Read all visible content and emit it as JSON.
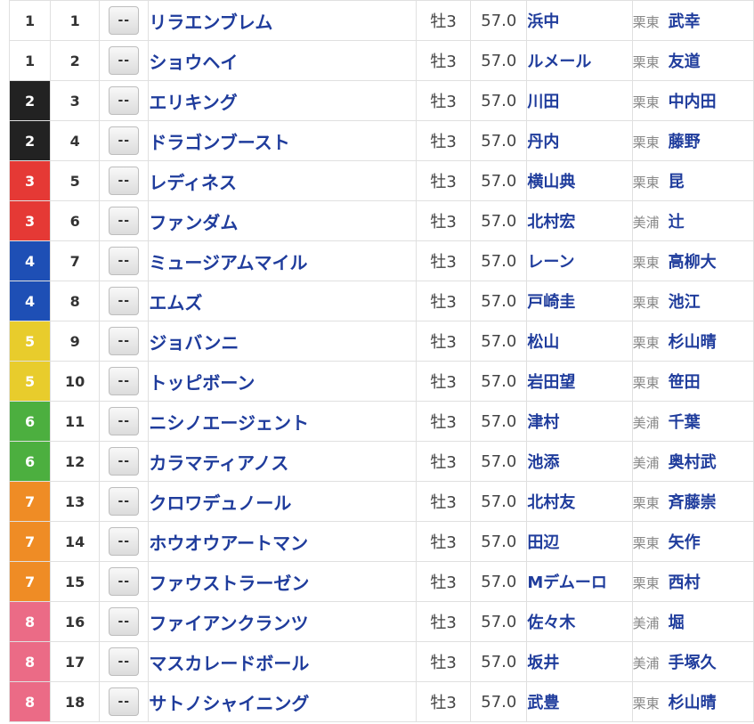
{
  "colors": {
    "waku": {
      "1": [
        "#ffffff",
        "#333333"
      ],
      "2": [
        "#222222",
        "#ffffff"
      ],
      "3": [
        "#e53935",
        "#ffffff"
      ],
      "4": [
        "#1e4fb5",
        "#ffffff"
      ],
      "5": [
        "#e8cc2c",
        "#ffffff"
      ],
      "6": [
        "#4caf3f",
        "#ffffff"
      ],
      "7": [
        "#ef8c25",
        "#ffffff"
      ],
      "8": [
        "#eb6b86",
        "#ffffff"
      ]
    },
    "link": "#1f3c9c"
  },
  "entries": [
    {
      "waku": "1",
      "umaban": "1",
      "mark": "--",
      "horse": "リラエンブレム",
      "sexage": "牡3",
      "weight": "57.0",
      "jockey": "浜中",
      "stable": "栗東",
      "trainer": "武幸"
    },
    {
      "waku": "1",
      "umaban": "2",
      "mark": "--",
      "horse": "ショウヘイ",
      "sexage": "牡3",
      "weight": "57.0",
      "jockey": "ルメール",
      "stable": "栗東",
      "trainer": "友道"
    },
    {
      "waku": "2",
      "umaban": "3",
      "mark": "--",
      "horse": "エリキング",
      "sexage": "牡3",
      "weight": "57.0",
      "jockey": "川田",
      "stable": "栗東",
      "trainer": "中内田"
    },
    {
      "waku": "2",
      "umaban": "4",
      "mark": "--",
      "horse": "ドラゴンブースト",
      "sexage": "牡3",
      "weight": "57.0",
      "jockey": "丹内",
      "stable": "栗東",
      "trainer": "藤野"
    },
    {
      "waku": "3",
      "umaban": "5",
      "mark": "--",
      "horse": "レディネス",
      "sexage": "牡3",
      "weight": "57.0",
      "jockey": "横山典",
      "stable": "栗東",
      "trainer": "昆"
    },
    {
      "waku": "3",
      "umaban": "6",
      "mark": "--",
      "horse": "ファンダム",
      "sexage": "牡3",
      "weight": "57.0",
      "jockey": "北村宏",
      "stable": "美浦",
      "trainer": "辻"
    },
    {
      "waku": "4",
      "umaban": "7",
      "mark": "--",
      "horse": "ミュージアムマイル",
      "sexage": "牡3",
      "weight": "57.0",
      "jockey": "レーン",
      "stable": "栗東",
      "trainer": "高柳大"
    },
    {
      "waku": "4",
      "umaban": "8",
      "mark": "--",
      "horse": "エムズ",
      "sexage": "牡3",
      "weight": "57.0",
      "jockey": "戸崎圭",
      "stable": "栗東",
      "trainer": "池江"
    },
    {
      "waku": "5",
      "umaban": "9",
      "mark": "--",
      "horse": "ジョバンニ",
      "sexage": "牡3",
      "weight": "57.0",
      "jockey": "松山",
      "stable": "栗東",
      "trainer": "杉山晴"
    },
    {
      "waku": "5",
      "umaban": "10",
      "mark": "--",
      "horse": "トッピボーン",
      "sexage": "牡3",
      "weight": "57.0",
      "jockey": "岩田望",
      "stable": "栗東",
      "trainer": "笹田"
    },
    {
      "waku": "6",
      "umaban": "11",
      "mark": "--",
      "horse": "ニシノエージェント",
      "sexage": "牡3",
      "weight": "57.0",
      "jockey": "津村",
      "stable": "美浦",
      "trainer": "千葉"
    },
    {
      "waku": "6",
      "umaban": "12",
      "mark": "--",
      "horse": "カラマティアノス",
      "sexage": "牡3",
      "weight": "57.0",
      "jockey": "池添",
      "stable": "美浦",
      "trainer": "奥村武"
    },
    {
      "waku": "7",
      "umaban": "13",
      "mark": "--",
      "horse": "クロワデュノール",
      "sexage": "牡3",
      "weight": "57.0",
      "jockey": "北村友",
      "stable": "栗東",
      "trainer": "斉藤崇"
    },
    {
      "waku": "7",
      "umaban": "14",
      "mark": "--",
      "horse": "ホウオウアートマン",
      "sexage": "牡3",
      "weight": "57.0",
      "jockey": "田辺",
      "stable": "栗東",
      "trainer": "矢作"
    },
    {
      "waku": "7",
      "umaban": "15",
      "mark": "--",
      "horse": "ファウストラーゼン",
      "sexage": "牡3",
      "weight": "57.0",
      "jockey": "Mデムーロ",
      "stable": "栗東",
      "trainer": "西村"
    },
    {
      "waku": "8",
      "umaban": "16",
      "mark": "--",
      "horse": "ファイアンクランツ",
      "sexage": "牡3",
      "weight": "57.0",
      "jockey": "佐々木",
      "stable": "美浦",
      "trainer": "堀"
    },
    {
      "waku": "8",
      "umaban": "17",
      "mark": "--",
      "horse": "マスカレードボール",
      "sexage": "牡3",
      "weight": "57.0",
      "jockey": "坂井",
      "stable": "美浦",
      "trainer": "手塚久"
    },
    {
      "waku": "8",
      "umaban": "18",
      "mark": "--",
      "horse": "サトノシャイニング",
      "sexage": "牡3",
      "weight": "57.0",
      "jockey": "武豊",
      "stable": "栗東",
      "trainer": "杉山晴"
    }
  ]
}
